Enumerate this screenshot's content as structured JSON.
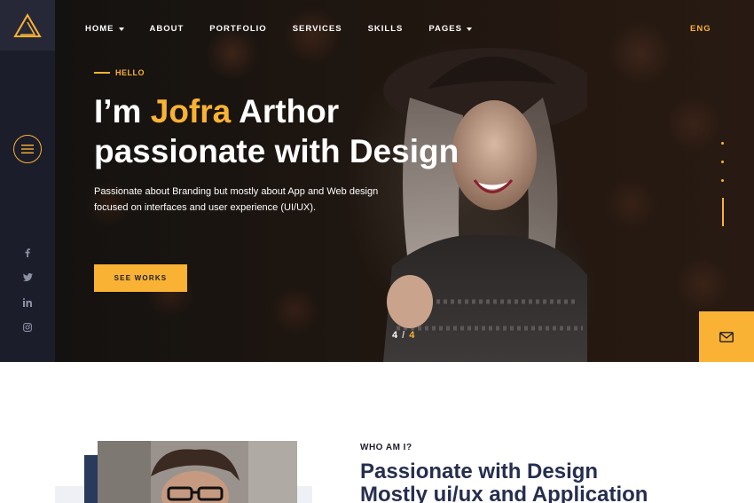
{
  "brand": {
    "logo": "triangle-logo-icon"
  },
  "nav": {
    "items": [
      {
        "label": "HOME",
        "has_caret": true
      },
      {
        "label": "ABOUT",
        "has_caret": false
      },
      {
        "label": "PORTFOLIO",
        "has_caret": false
      },
      {
        "label": "SERVICES",
        "has_caret": false
      },
      {
        "label": "SKILLS",
        "has_caret": false
      },
      {
        "label": "PAGES",
        "has_caret": true
      }
    ],
    "language": "ENG"
  },
  "sidebar": {
    "menu_icon": "hamburger-icon",
    "social": [
      "facebook-icon",
      "twitter-icon",
      "linkedin-icon",
      "instagram-icon"
    ]
  },
  "hero": {
    "eyebrow": "HELLO",
    "headline_prefix": "I’m ",
    "headline_name": "Jofra",
    "headline_suffix": " Arthor",
    "headline_line2": "passionate with Design",
    "description_line1": "Passionate about Branding but mostly about App and Web design",
    "description_line2": "focused on interfaces and user experience (UI/UX).",
    "cta_label": "SEE WORKS",
    "slide_current": "4",
    "slide_separator": "/",
    "slide_total": "4"
  },
  "about": {
    "eyebrow": "WHO AM I?",
    "title_line1": "Passionate with Design",
    "title_line2": "Mostly ui/ux and Application"
  },
  "colors": {
    "accent": "#f9b234",
    "sidebar": "#1c1d2a",
    "heading": "#262e4f"
  }
}
